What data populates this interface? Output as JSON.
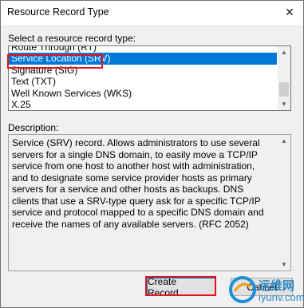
{
  "window": {
    "title": "Resource Record Type"
  },
  "list": {
    "label": "Select a resource record type:",
    "items": [
      "Route Through (RT)",
      "Service Location (SRV)",
      "Signature (SIG)",
      "Text (TXT)",
      "Well Known Services (WKS)",
      "X.25"
    ],
    "selected": "Service Location (SRV)"
  },
  "description": {
    "label": "Description:",
    "text": "Service (SRV) record. Allows administrators to use several servers for a single DNS domain, to easily move a TCP/IP service from one host to another host with administration, and to designate some service provider hosts as primary servers for a service and other hosts as backups. DNS clients that use a SRV-type query ask for a specific TCP/IP service and protocol mapped to a specific DNS domain and receive the names of any available servers. (RFC 2052)"
  },
  "buttons": {
    "create": "Create Record...",
    "cancel": "Cancel"
  },
  "watermark": {
    "line1": "运维网",
    "line2": "iyunv.com"
  },
  "colors": {
    "selection": "#0078d7",
    "annotation_red": "#e0151f"
  }
}
